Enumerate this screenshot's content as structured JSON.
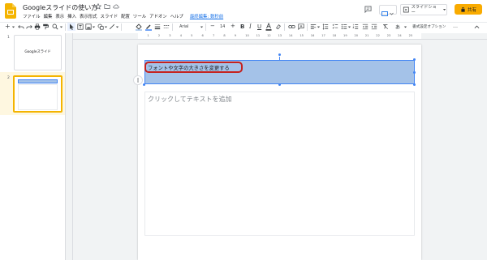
{
  "doc": {
    "title": "Googleスライドの使い方",
    "last_edit": "最終編集: 数秒前"
  },
  "menu": [
    "ファイル",
    "編集",
    "表示",
    "挿入",
    "表示形式",
    "スライド",
    "配置",
    "ツール",
    "アドオン",
    "ヘルプ"
  ],
  "header": {
    "slideshow_label": "スライドショー",
    "share_label": "共有"
  },
  "toolbar": {
    "font_name": "Arial",
    "font_size": "14",
    "format_options": "書式設定オプション",
    "more": "…"
  },
  "ruler": {
    "ticks": [
      "1",
      "2",
      "3",
      "4",
      "5",
      "6",
      "7",
      "8",
      "9",
      "10",
      "11",
      "12",
      "13",
      "14",
      "15",
      "16",
      "17",
      "18",
      "19",
      "20",
      "21",
      "22",
      "23",
      "24",
      "25"
    ]
  },
  "slides": [
    {
      "number": "1",
      "title": "Googleスライド"
    },
    {
      "number": "2",
      "title": ""
    }
  ],
  "canvas": {
    "title_text": "フォントや文字の大きさを変更する",
    "body_placeholder": "クリックしてテキストを追加"
  },
  "colors": {
    "slides_yellow": "#f4b400",
    "selection_fill": "#a4c2e8",
    "selection_border": "#4285f4",
    "highlight_ring": "#c5221f",
    "share_bg": "#f9ab00"
  }
}
